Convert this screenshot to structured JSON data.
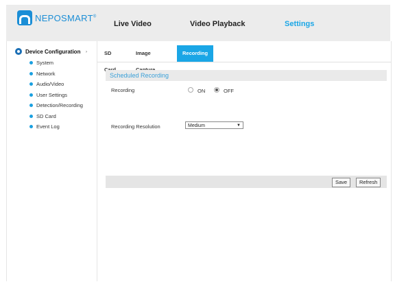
{
  "brand": {
    "name": "NEPOSMART",
    "tm": "®",
    "color": "#1b8ed6"
  },
  "nav": {
    "live_video": "Live Video",
    "video_playback": "Video Playback",
    "settings": "Settings",
    "active": "Settings",
    "accent_color": "#1aa6e6"
  },
  "sidebar": {
    "heading": "Device Configuration",
    "caret": "›",
    "items": [
      {
        "label": "System"
      },
      {
        "label": "Network"
      },
      {
        "label": "Audio/Video"
      },
      {
        "label": "User Settings"
      },
      {
        "label": "Detection/Recording"
      },
      {
        "label": "SD Card"
      },
      {
        "label": "Event Log"
      }
    ]
  },
  "tabs": [
    {
      "label": "SD Card",
      "active": false
    },
    {
      "label": "Image Capture",
      "active": false
    },
    {
      "label": "Recording",
      "active": true
    }
  ],
  "form": {
    "section_title": "Scheduled Recording",
    "recording_label": "Recording",
    "on_label": "ON",
    "off_label": "OFF",
    "recording_selected": "OFF",
    "resolution_label": "Recording Resolution",
    "resolution_value": "Medium"
  },
  "actions": {
    "save": "Save",
    "refresh": "Refresh"
  }
}
